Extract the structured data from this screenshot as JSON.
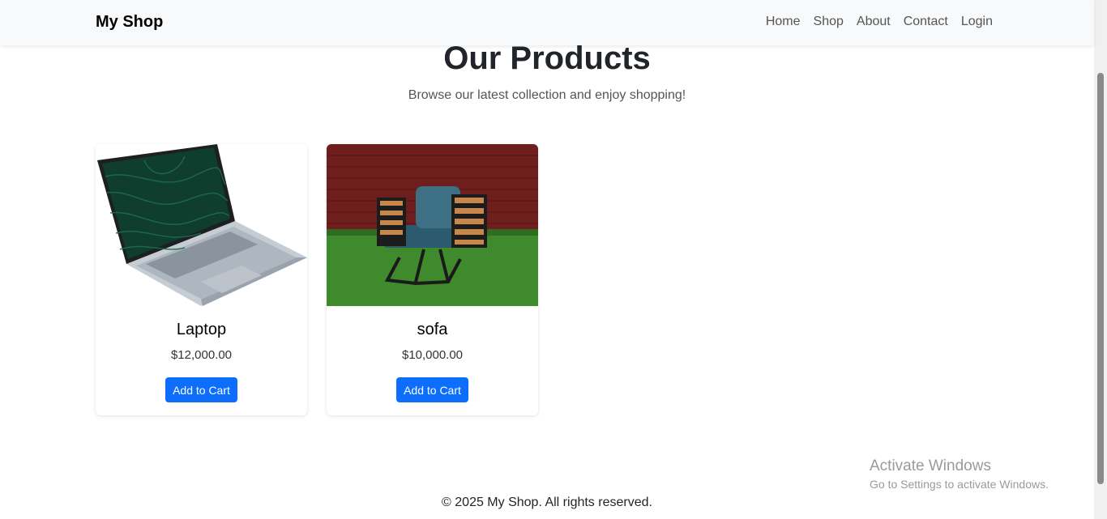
{
  "navbar": {
    "brand": "My Shop",
    "links": [
      "Home",
      "Shop",
      "About",
      "Contact",
      "Login"
    ]
  },
  "hero": {
    "title": "Our Products",
    "subtitle": "Browse our latest collection and enjoy shopping!"
  },
  "products": [
    {
      "name": "Laptop",
      "price": "$12,000.00",
      "button": "Add to Cart",
      "image": "laptop-photo"
    },
    {
      "name": "sofa",
      "price": "$10,000.00",
      "button": "Add to Cart",
      "image": "armchair-photo"
    }
  ],
  "watermark": {
    "line1": "Activate Windows",
    "line2": "Go to Settings to activate Windows."
  },
  "footer": {
    "text": "© 2025 My Shop. All rights reserved."
  }
}
